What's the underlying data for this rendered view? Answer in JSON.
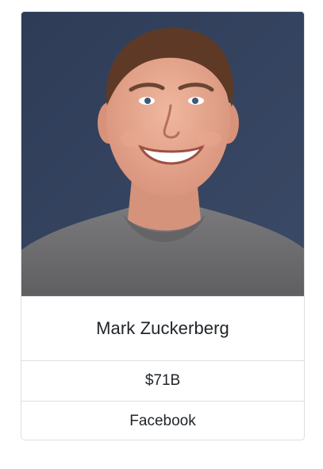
{
  "card": {
    "image_alt": "Mark Zuckerberg",
    "name": "Mark Zuckerberg",
    "net_worth": "$71B",
    "company": "Facebook"
  },
  "colors": {
    "photo_background": "#34435f",
    "shirt": "#6e6e70",
    "skin": "#e4a48b",
    "hair": "#5e3a26",
    "border": "rgba(0,0,0,0.125)",
    "text": "#212529"
  }
}
